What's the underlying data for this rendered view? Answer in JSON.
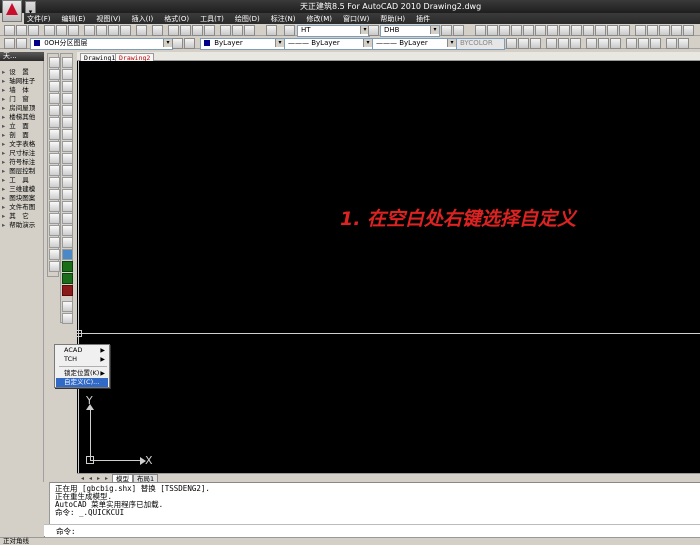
{
  "window": {
    "title": "天正建筑8.5 For AutoCAD 2010    Drawing2.dwg"
  },
  "menubar": [
    "文件(F)",
    "编辑(E)",
    "视图(V)",
    "插入(I)",
    "格式(O)",
    "工具(T)",
    "绘图(D)",
    "标注(N)",
    "修改(M)",
    "窗口(W)",
    "帮助(H)",
    "插件"
  ],
  "toolbar": {
    "textstyle": "HT",
    "dimstyle": "DHB",
    "layer": "0OH分区图层",
    "color": "ByLayer",
    "linetype": "ByLayer",
    "lineweight": "ByLayer",
    "plotstyle": "BYCOLOR"
  },
  "palette": {
    "title": "天...",
    "items": [
      "设　置",
      "轴网柱子",
      "墙　体",
      "门　窗",
      "房间屋顶",
      "楼梯其他",
      "立　面",
      "剖　面",
      "文字表格",
      "尺寸标注",
      "符号标注",
      "图层控制",
      "工　具",
      "三维建模",
      "图块图案",
      "文件布图",
      "其　它",
      "帮助演示"
    ]
  },
  "drawing_tabs": [
    "Drawing1",
    "Drawing2"
  ],
  "annotation": "1. 在空白处右键选择自定义",
  "ucs": {
    "x_label": "X",
    "y_label": "Y"
  },
  "context_menu": {
    "items": [
      {
        "label": "ACAD",
        "submenu": true
      },
      {
        "label": "TCH",
        "submenu": true
      },
      {
        "label": "锁定位置(K)",
        "submenu": true
      },
      {
        "label": "自定义(C)...",
        "submenu": false,
        "highlighted": true
      }
    ]
  },
  "layout_tabs": [
    "模型",
    "布局1"
  ],
  "command": {
    "lines": [
      "正在用 [gbcbig.shx] 替换 [TSSDENG2].",
      "正在重生成模型.",
      "AutoCAD 菜单实用程序已加载.",
      "命令: _.QUICKCUI"
    ],
    "prompt": "命令:"
  },
  "status": {
    "text": "正对角线"
  },
  "colors": {
    "canvas": "#000000",
    "annotation": "#dd2222",
    "menu_highlight": "#3169c6"
  }
}
